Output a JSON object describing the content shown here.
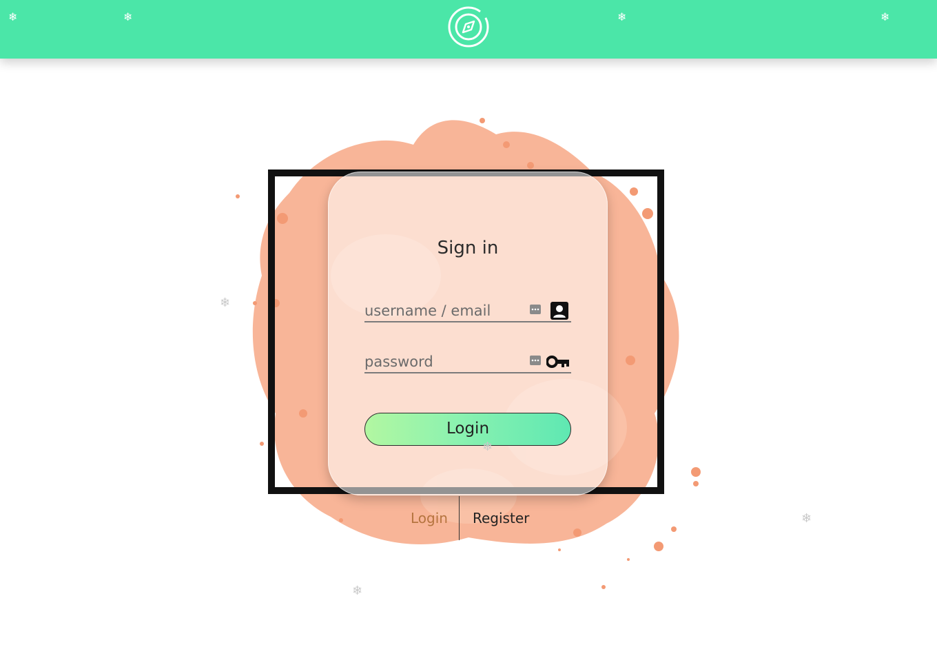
{
  "header": {
    "logo_icon": "compass-icon",
    "background_color": "#4be6a8"
  },
  "login_card": {
    "title": "Sign in",
    "username_placeholder": "username / email",
    "password_placeholder": "password",
    "username_icon": "contact-card-icon",
    "password_icon": "key-icon",
    "autofill_icon": "password-manager-icon",
    "submit_label": "Login",
    "accent_color": "#4be6a8",
    "splash_color": "#f7a886"
  },
  "tabs": {
    "login_label": "Login",
    "register_label": "Register",
    "active_color": "#b5743f"
  }
}
